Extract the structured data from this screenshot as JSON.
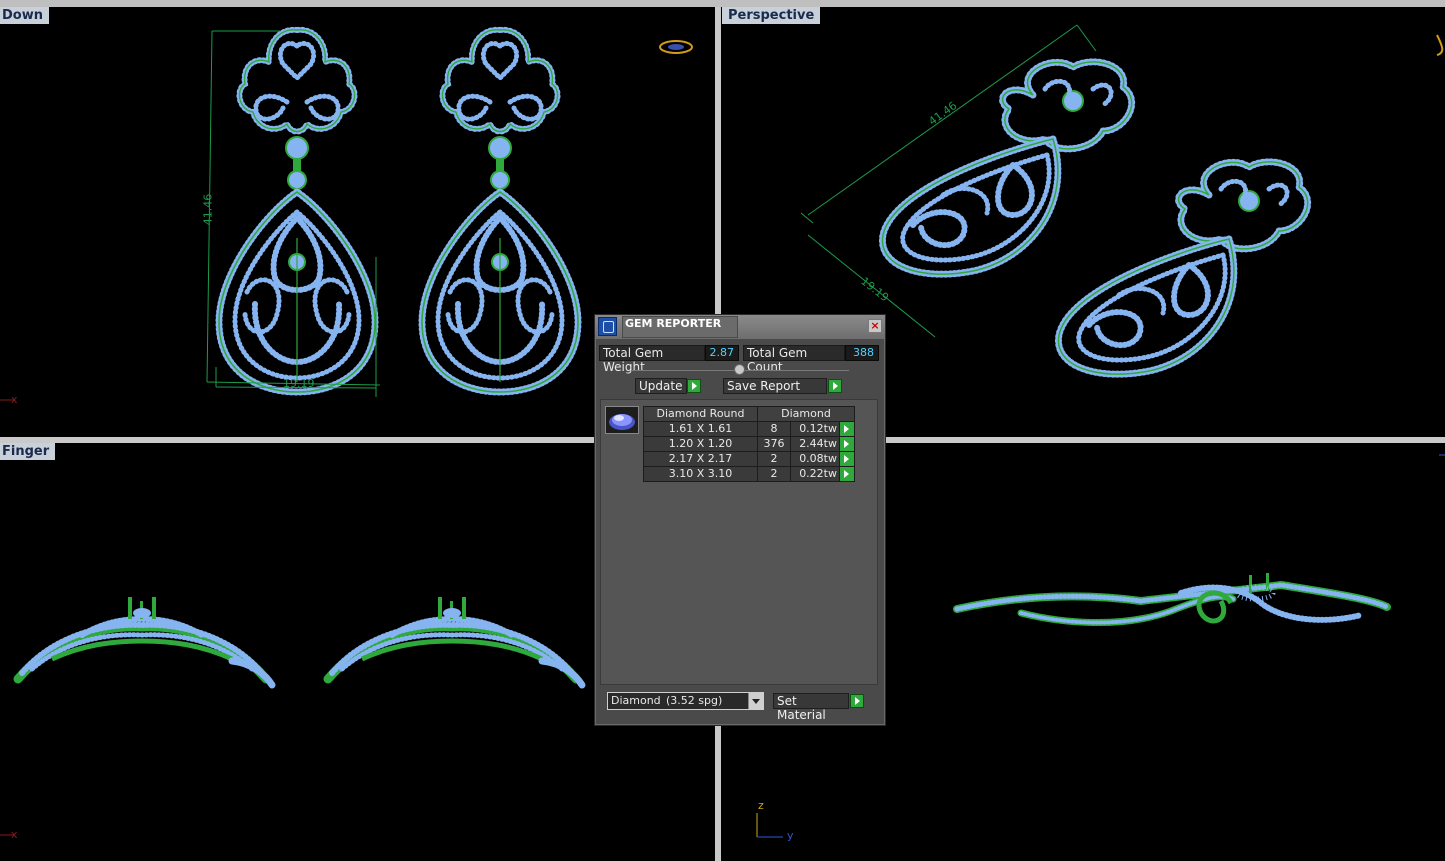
{
  "viewports": {
    "top": {
      "label": "Down"
    },
    "perspective": {
      "label": "Perspective",
      "dim_length": "41.46",
      "dim_width": "19.19"
    },
    "front": {
      "label": "Finger"
    },
    "right": {
      "axis_z": "z",
      "axis_y": "y"
    }
  },
  "top_dims": {
    "length": "41.46",
    "width": "19.19"
  },
  "axis_x": "x",
  "gem_reporter": {
    "title": "GEM REPORTER",
    "total_weight_label": "Total Gem Weight",
    "total_weight_value": "2.87",
    "total_count_label": "Total Gem Count",
    "total_count_value": "388",
    "update_label": "Update",
    "save_report_label": "Save Report",
    "table": {
      "headers": [
        "Diamond Round",
        "Diamond"
      ],
      "rows": [
        {
          "size": "1.61 X 1.61",
          "count": "8",
          "weight": "0.12tw"
        },
        {
          "size": "1.20 X 1.20",
          "count": "376",
          "weight": "2.44tw"
        },
        {
          "size": "2.17 X 2.17",
          "count": "2",
          "weight": "0.08tw"
        },
        {
          "size": "3.10 X 3.10",
          "count": "2",
          "weight": "0.22tw"
        }
      ]
    },
    "material_value": "Diamond",
    "material_spg": "(3.52 spg)",
    "set_material_label": "Set Material"
  },
  "colors": {
    "gem": "#86b4f0",
    "metal": "#2fa83c",
    "dimension": "#1d9b4a",
    "label_bg": "#c8d0da",
    "readout": "#4fd2ff"
  }
}
